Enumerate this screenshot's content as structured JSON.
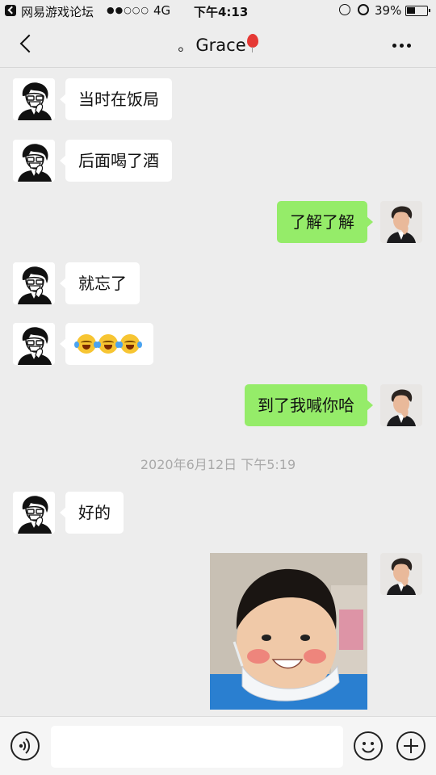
{
  "status_bar": {
    "carrier": "网易游戏论坛",
    "signal": "●●○○○",
    "network": "4G",
    "time": "下午4:13",
    "battery": "39%"
  },
  "nav": {
    "dot": "。",
    "title": "Grace",
    "back_icon": "chevron-left-icon",
    "more_icon": "more-dots-icon"
  },
  "messages": [
    {
      "side": "them",
      "text": "当时在饭局"
    },
    {
      "side": "them",
      "text": "后面喝了酒"
    },
    {
      "side": "me",
      "text": "了解了解"
    },
    {
      "side": "them",
      "text": "就忘了"
    },
    {
      "side": "them",
      "emoji": [
        "laugh-cry-emoji",
        "laugh-cry-emoji",
        "laugh-cry-emoji"
      ]
    },
    {
      "side": "me",
      "text": "到了我喊你哈"
    },
    {
      "side": "them",
      "text": "好的"
    },
    {
      "side": "me",
      "image": "smiling-child-photo"
    }
  ],
  "timestamp": "2020年6月12日 下午5:19",
  "colors": {
    "background": "#ededed",
    "my_bubble": "#95ec69",
    "their_bubble": "#ffffff",
    "timestamp": "#a9a9a9"
  },
  "input_bar": {
    "voice_icon": "voice-icon",
    "emoji_icon": "emoji-icon",
    "plus_icon": "plus-icon",
    "text_value": ""
  }
}
